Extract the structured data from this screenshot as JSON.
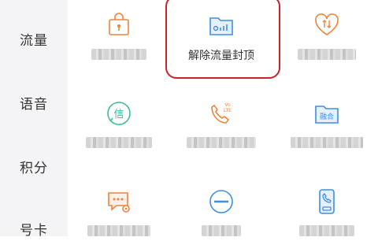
{
  "sidebar": {
    "items": [
      {
        "label": "流量"
      },
      {
        "label": "语音"
      },
      {
        "label": "积分"
      },
      {
        "label": "号卡"
      }
    ]
  },
  "grid": {
    "items": [
      {
        "label": "",
        "icon": "lock-briefcase-icon",
        "blurred": true
      },
      {
        "label": "解除流量封顶",
        "icon": "data-folder-icon",
        "blurred": false,
        "highlighted": true
      },
      {
        "label": "",
        "icon": "heart-data-icon",
        "blurred": true
      },
      {
        "label": "",
        "icon": "xin-message-icon",
        "icon_text": "信",
        "blurred": true
      },
      {
        "label": "",
        "icon": "volte-phone-icon",
        "icon_text": "Vo LTE",
        "blurred": true
      },
      {
        "label": "",
        "icon": "ronghe-folder-icon",
        "icon_text": "融合",
        "blurred": true
      },
      {
        "label": "",
        "icon": "message-gear-icon",
        "blurred": true
      },
      {
        "label": "",
        "icon": "minus-circle-icon",
        "blurred": true
      },
      {
        "label": "",
        "icon": "phone-card-icon",
        "blurred": true
      }
    ]
  },
  "colors": {
    "orange": "#f0833a",
    "blue": "#3d8fe8",
    "green": "#3cbf90",
    "highlight": "#c8252b"
  }
}
